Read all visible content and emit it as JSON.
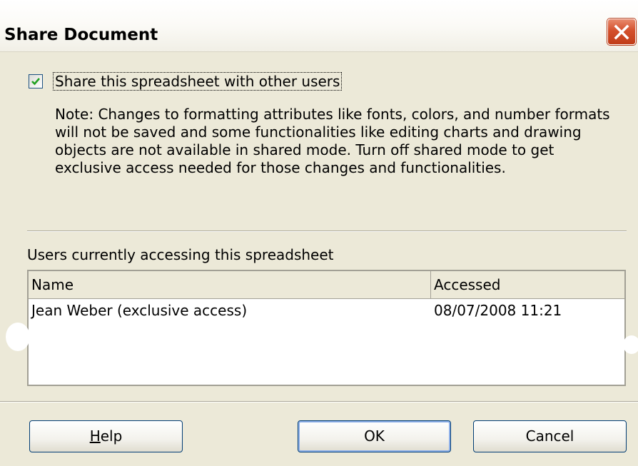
{
  "window": {
    "title": "Share Document"
  },
  "share": {
    "checkbox_label": "Share this spreadsheet with other users",
    "checked": true,
    "note": "Note: Changes to formatting attributes like fonts, colors, and number formats will not be saved and some functionalities like editing charts and drawing objects are not available in shared mode. Turn off shared mode to get exclusive access needed for those changes and functionalities."
  },
  "users": {
    "caption": "Users currently accessing this spreadsheet",
    "columns": [
      "Name",
      "Accessed"
    ],
    "rows": [
      {
        "name": "Jean Weber (exclusive access)",
        "accessed": "08/07/2008 11:21"
      }
    ]
  },
  "buttons": {
    "help": "Help",
    "help_mnemonic": "H",
    "help_rest": "elp",
    "ok": "OK",
    "cancel": "Cancel"
  },
  "icons": {
    "close": "close-icon",
    "check": "checkmark-icon"
  },
  "colors": {
    "dialog_bg": "#ece9d8",
    "close_red": "#d4502c",
    "check_green": "#21a121",
    "border": "#a2a095"
  }
}
